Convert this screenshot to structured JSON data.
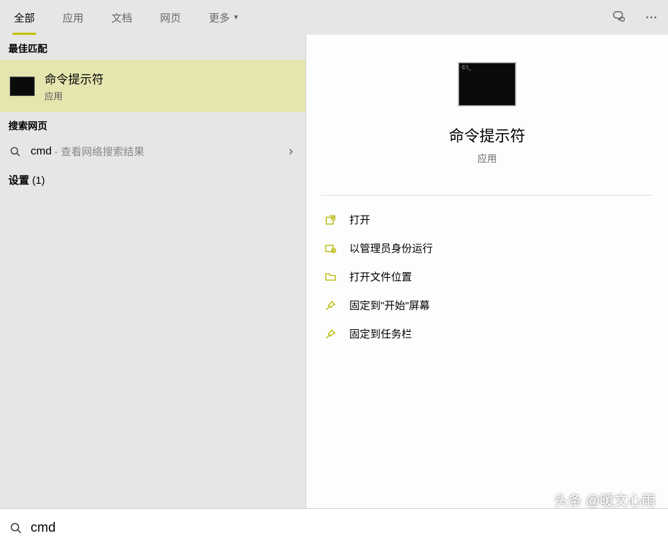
{
  "tabs": {
    "all": "全部",
    "apps": "应用",
    "docs": "文档",
    "web": "网页",
    "more": "更多"
  },
  "sections": {
    "best": "最佳匹配",
    "web": "搜索网页",
    "settings_label": "设置",
    "settings_count": "(1)"
  },
  "best": {
    "title": "命令提示符",
    "subtitle": "应用"
  },
  "webResult": {
    "query": "cmd",
    "hint": "- 查看网络搜索结果"
  },
  "preview": {
    "title": "命令提示符",
    "subtitle": "应用"
  },
  "actions": {
    "open": "打开",
    "runAdmin": "以管理员身份运行",
    "openLocation": "打开文件位置",
    "pinStart": "固定到\"开始\"屏幕",
    "pinTaskbar": "固定到任务栏"
  },
  "search": {
    "value": "cmd"
  },
  "watermark": "头条 @暖文心雨"
}
